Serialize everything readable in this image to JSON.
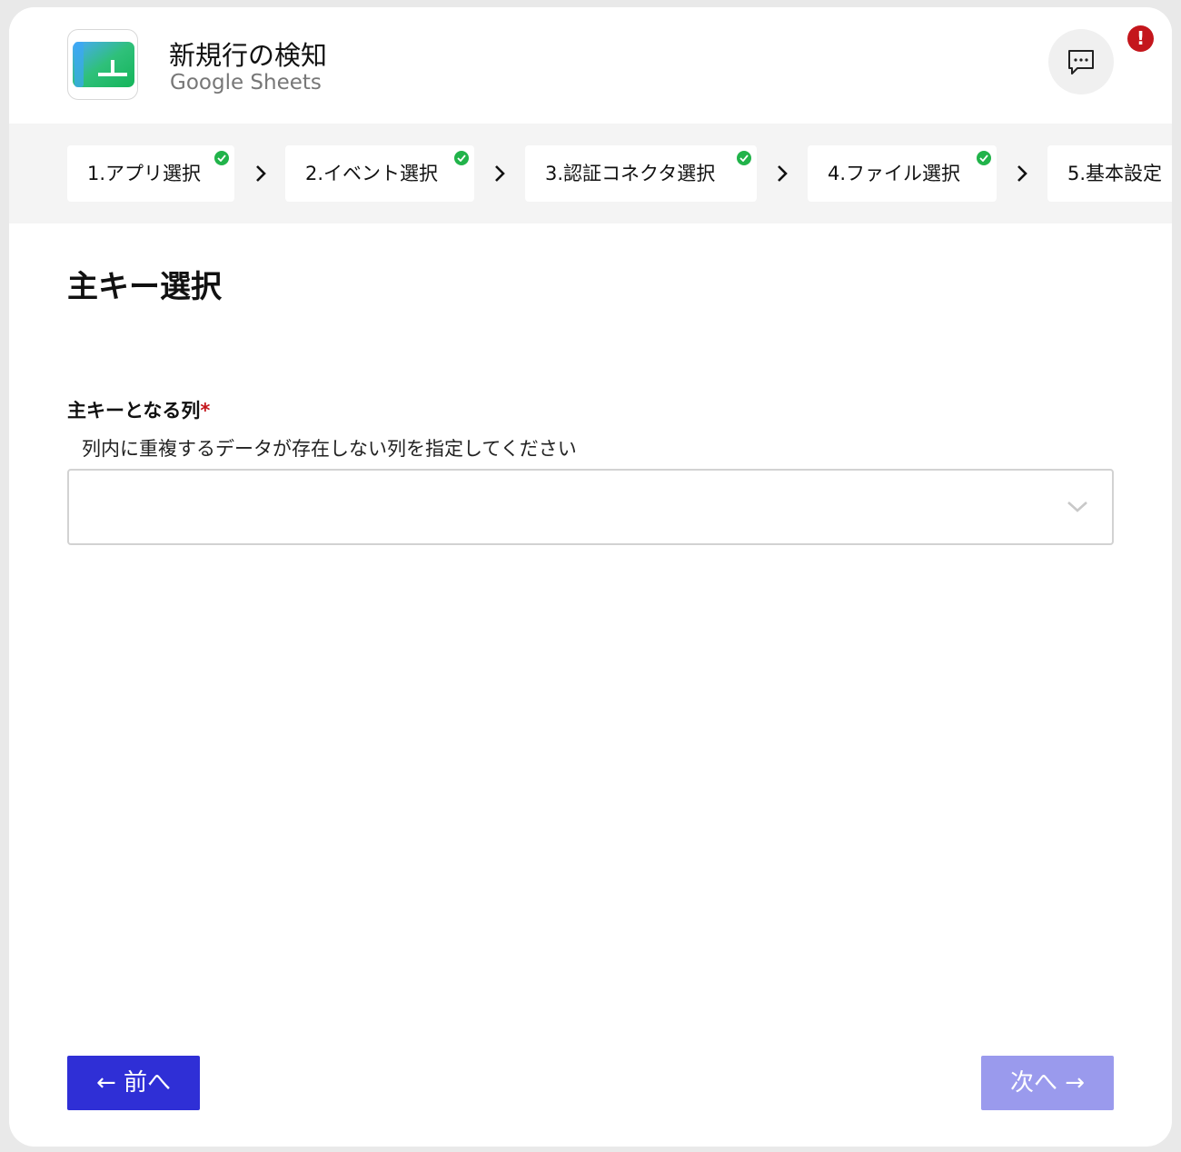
{
  "header": {
    "title": "新規行の検知",
    "subtitle": "Google Sheets",
    "alert_symbol": "!",
    "icons": {
      "app": "google-sheets-icon",
      "chat": "chat-bubble-icon"
    }
  },
  "stepper": {
    "steps": [
      {
        "label": "1.アプリ選択",
        "completed": true
      },
      {
        "label": "2.イベント選択",
        "completed": true
      },
      {
        "label": "3.認証コネクタ選択",
        "completed": true
      },
      {
        "label": "4.ファイル選択",
        "completed": true
      },
      {
        "label": "5.基本設定",
        "completed": false
      }
    ]
  },
  "main": {
    "section_title": "主キー選択",
    "field": {
      "label": "主キーとなる列",
      "required_mark": "*",
      "help": "列内に重複するデータが存在しない列を指定してください",
      "selected_value": ""
    }
  },
  "footer": {
    "prev_label": "← 前へ",
    "next_label": "次へ →"
  },
  "colors": {
    "primary": "#2f2fd6",
    "primary_disabled": "#9a9aed",
    "success": "#21b34a",
    "error": "#c4161c"
  }
}
